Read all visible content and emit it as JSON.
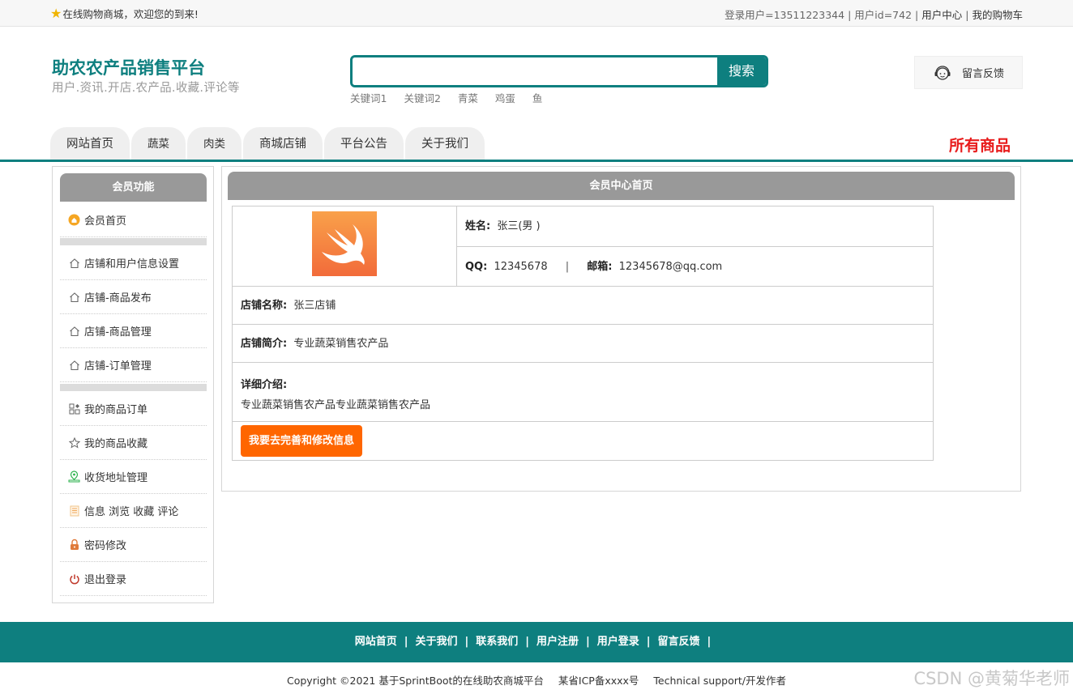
{
  "topbar": {
    "welcome": "在线购物商城，欢迎您的到来!",
    "login_user": "登录用户=13511223344",
    "user_id": "用户id=742",
    "user_center": "用户中心",
    "cart": "我的购物车"
  },
  "header": {
    "title": "助农农产品销售平台",
    "subtitle": "用户.资讯.开店.农产品.收藏.评论等",
    "search_button": "搜索",
    "search_value": "",
    "hot_keywords": [
      "关键词1",
      "关键词2",
      "青菜",
      "鸡蛋",
      "鱼"
    ],
    "feedback": "留言反馈"
  },
  "nav": {
    "tabs": [
      "网站首页",
      "蔬菜",
      "肉类",
      "商城店铺",
      "平台公告",
      "关于我们"
    ],
    "all_goods": "所有商品"
  },
  "sidebar": {
    "title": "会员功能",
    "items": [
      {
        "label": "会员首页",
        "icon": "member-home-icon"
      },
      {
        "label": "店铺和用户信息设置",
        "icon": "house-icon"
      },
      {
        "label": "店铺-商品发布",
        "icon": "house-icon"
      },
      {
        "label": "店铺-商品管理",
        "icon": "house-icon"
      },
      {
        "label": "店铺-订单管理",
        "icon": "house-icon"
      },
      {
        "label": "我的商品订单",
        "icon": "grid-icon"
      },
      {
        "label": "我的商品收藏",
        "icon": "star-icon"
      },
      {
        "label": "收货地址管理",
        "icon": "location-icon"
      },
      {
        "label": "信息 浏览 收藏 评论",
        "icon": "document-icon"
      },
      {
        "label": "密码修改",
        "icon": "lock-icon"
      },
      {
        "label": "退出登录",
        "icon": "power-icon"
      }
    ]
  },
  "main": {
    "title": "会员中心首页",
    "name_label": "姓名:",
    "name_value": "张三(男 )",
    "qq_label": "QQ:",
    "qq_value": "12345678",
    "separator": "|",
    "email_label": "邮箱:",
    "email_value": "12345678@qq.com",
    "shop_name_label": "店铺名称:",
    "shop_name_value": "张三店铺",
    "shop_intro_label": "店铺简介:",
    "shop_intro_value": "专业蔬菜销售农产品",
    "detail_label": "详细介绍:",
    "detail_value": "专业蔬菜销售农产品专业蔬菜销售农产品",
    "edit_button": "我要去完善和修改信息"
  },
  "footer": {
    "links": [
      "网站首页",
      "关于我们",
      "联系我们",
      "用户注册",
      "用户登录",
      "留言反馈"
    ],
    "link_separator": "|",
    "copyright": "Copyright ©2021 基于SprintBoot的在线助农商城平台",
    "icp": "某省ICP备xxxx号",
    "support": "Technical support/开发作者"
  },
  "watermark": "CSDN @黄菊华老师",
  "colors": {
    "brand": "#0e7f7f",
    "accent_orange": "#ff6600",
    "all_goods_red": "#e81c1c",
    "panel_header_gray": "#999999"
  }
}
